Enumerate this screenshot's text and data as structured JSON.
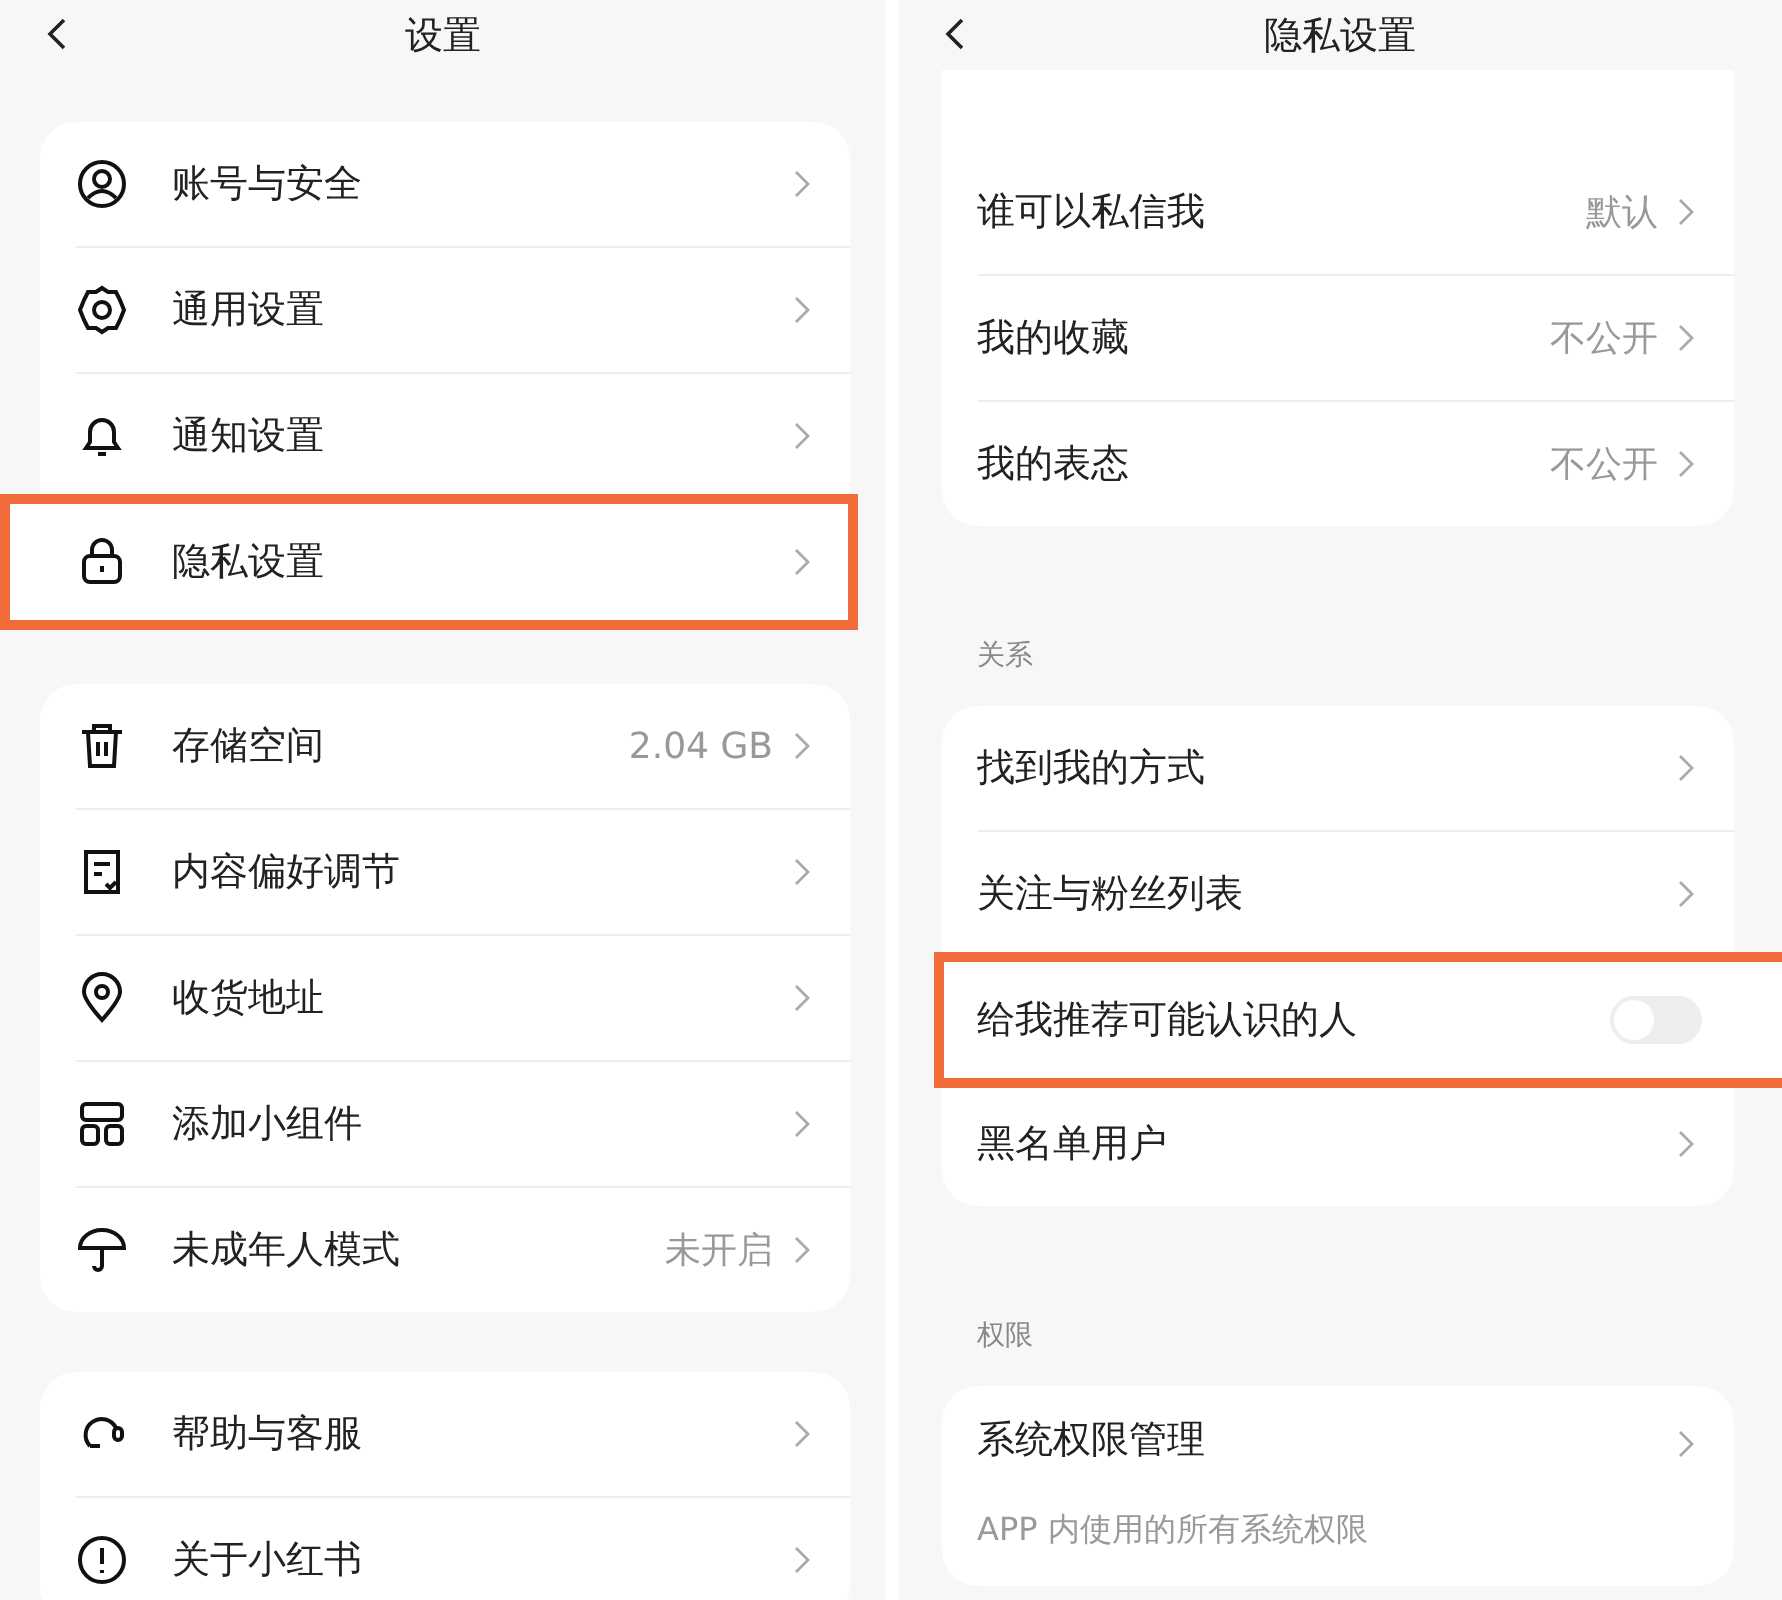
{
  "screens": [
    {
      "title": "设置",
      "groups": [
        {
          "items": [
            {
              "kind": "link",
              "label": "账号与安全",
              "highlighted": false
            },
            {
              "kind": "link",
              "label": "通用设置",
              "highlighted": false
            },
            {
              "kind": "link",
              "label": "通知设置",
              "highlighted": false
            },
            {
              "kind": "link",
              "label": "隐私设置",
              "highlighted": true
            }
          ]
        },
        {
          "items": [
            {
              "kind": "link",
              "label": "存储空间",
              "value": "2.04 GB",
              "highlighted": false
            },
            {
              "kind": "link",
              "label": "内容偏好调节",
              "highlighted": false
            },
            {
              "kind": "link",
              "label": "收货地址",
              "highlighted": false
            },
            {
              "kind": "link",
              "label": "添加小组件",
              "highlighted": false
            },
            {
              "kind": "link",
              "label": "未成年人模式",
              "value": "未开启",
              "highlighted": false
            }
          ]
        },
        {
          "items": [
            {
              "kind": "link",
              "label": "帮助与客服",
              "highlighted": false
            },
            {
              "kind": "link",
              "label": "关于小红书",
              "highlighted": false
            }
          ]
        }
      ]
    },
    {
      "title": "隐私设置",
      "groups": [
        {
          "items": [
            {
              "kind": "link",
              "label": "谁可以私信我",
              "value": "默认",
              "highlighted": false
            },
            {
              "kind": "link",
              "label": "我的收藏",
              "value": "不公开",
              "highlighted": false
            },
            {
              "kind": "link",
              "label": "我的表态",
              "value": "不公开",
              "highlighted": false
            }
          ]
        },
        {
          "heading": "关系",
          "items": [
            {
              "kind": "link",
              "label": "找到我的方式",
              "highlighted": false
            },
            {
              "kind": "link",
              "label": "关注与粉丝列表",
              "highlighted": false
            },
            {
              "kind": "toggle",
              "label": "给我推荐可能认识的人",
              "on": false,
              "highlighted": true
            },
            {
              "kind": "link",
              "label": "黑名单用户",
              "highlighted": false
            }
          ]
        },
        {
          "heading": "权限",
          "items": [
            {
              "kind": "link",
              "label": "系统权限管理",
              "description": "APP 内使用的所有系统权限",
              "highlighted": false
            }
          ]
        }
      ]
    }
  ]
}
